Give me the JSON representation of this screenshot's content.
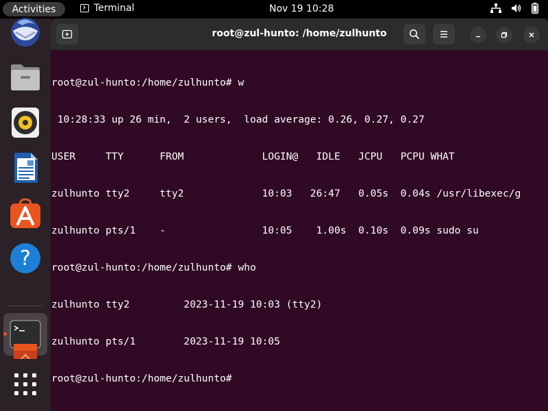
{
  "topbar": {
    "activities": "Activities",
    "app_name": "Terminal",
    "clock": "Nov 19  10:28"
  },
  "dock": {
    "items": [
      "thunderbird-icon",
      "files-icon",
      "rhythmbox-icon",
      "writer-icon",
      "app-center-icon",
      "help-icon",
      "terminal-icon",
      "rhythmbox-partial-icon",
      "show-apps-icon"
    ]
  },
  "window": {
    "title": "root@zul-hunto: /home/zulhunto"
  },
  "terminal": {
    "lines": [
      "root@zul-hunto:/home/zulhunto# w",
      " 10:28:33 up 26 min,  2 users,  load average: 0.26, 0.27, 0.27",
      "USER     TTY      FROM             LOGIN@   IDLE   JCPU   PCPU WHAT",
      "zulhunto tty2     tty2             10:03   26:47   0.05s  0.04s /usr/libexec/g",
      "zulhunto pts/1    -                10:05    1.00s  0.10s  0.09s sudo su",
      "root@zul-hunto:/home/zulhunto# who",
      "zulhunto tty2         2023-11-19 10:03 (tty2)",
      "zulhunto pts/1        2023-11-19 10:05",
      "root@zul-hunto:/home/zulhunto# "
    ]
  },
  "colors": {
    "terminal_bg": "#300a24",
    "accent": "#e95420",
    "headerbar": "#2c2c2c"
  }
}
